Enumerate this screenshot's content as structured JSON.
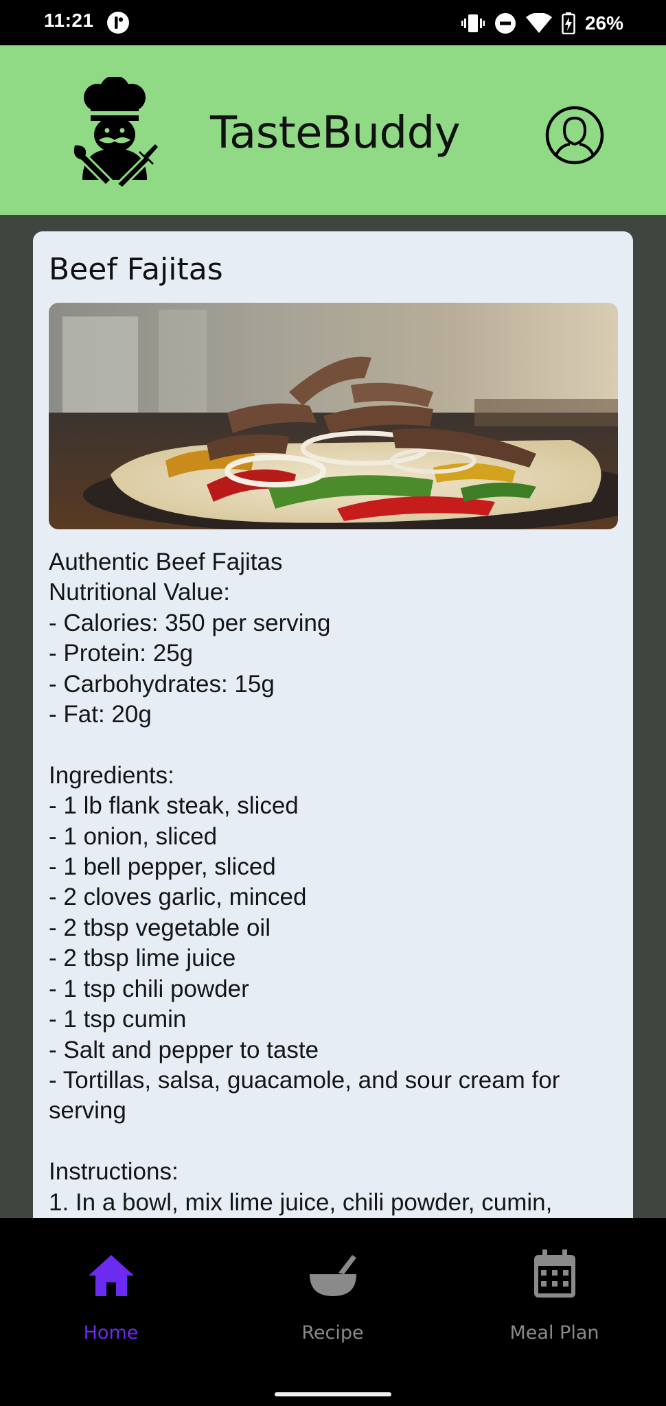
{
  "status_bar": {
    "time": "11:21",
    "battery": "26%"
  },
  "header": {
    "app_title": "TasteBuddy",
    "logo_icon": "chef-logo-icon",
    "profile_icon": "user-profile-icon",
    "background_color": "#90da86"
  },
  "recipe": {
    "title": "Beef Fajitas",
    "image_alt": "beef-fajitas-photo",
    "body": "Authentic Beef Fajitas\nNutritional Value:\n- Calories: 350 per serving\n- Protein: 25g\n- Carbohydrates: 15g\n- Fat: 20g\n\nIngredients:\n- 1 lb flank steak, sliced\n- 1 onion, sliced\n- 1 bell pepper, sliced\n- 2 cloves garlic, minced\n- 2 tbsp vegetable oil\n- 2 tbsp lime juice\n- 1 tsp chili powder\n- 1 tsp cumin\n- Salt and pepper to taste\n- Tortillas, salsa, guacamole, and sour cream for serving\n\nInstructions:\n1. In a bowl, mix lime juice, chili powder, cumin,"
  },
  "bottom_nav": {
    "items": [
      {
        "label": "Home",
        "icon": "home-icon",
        "active": true
      },
      {
        "label": "Recipe",
        "icon": "mixing-bowl-icon",
        "active": false
      },
      {
        "label": "Meal Plan",
        "icon": "calendar-icon",
        "active": false
      }
    ],
    "active_color": "#6b2bf0",
    "inactive_color": "#8a8a8a"
  }
}
